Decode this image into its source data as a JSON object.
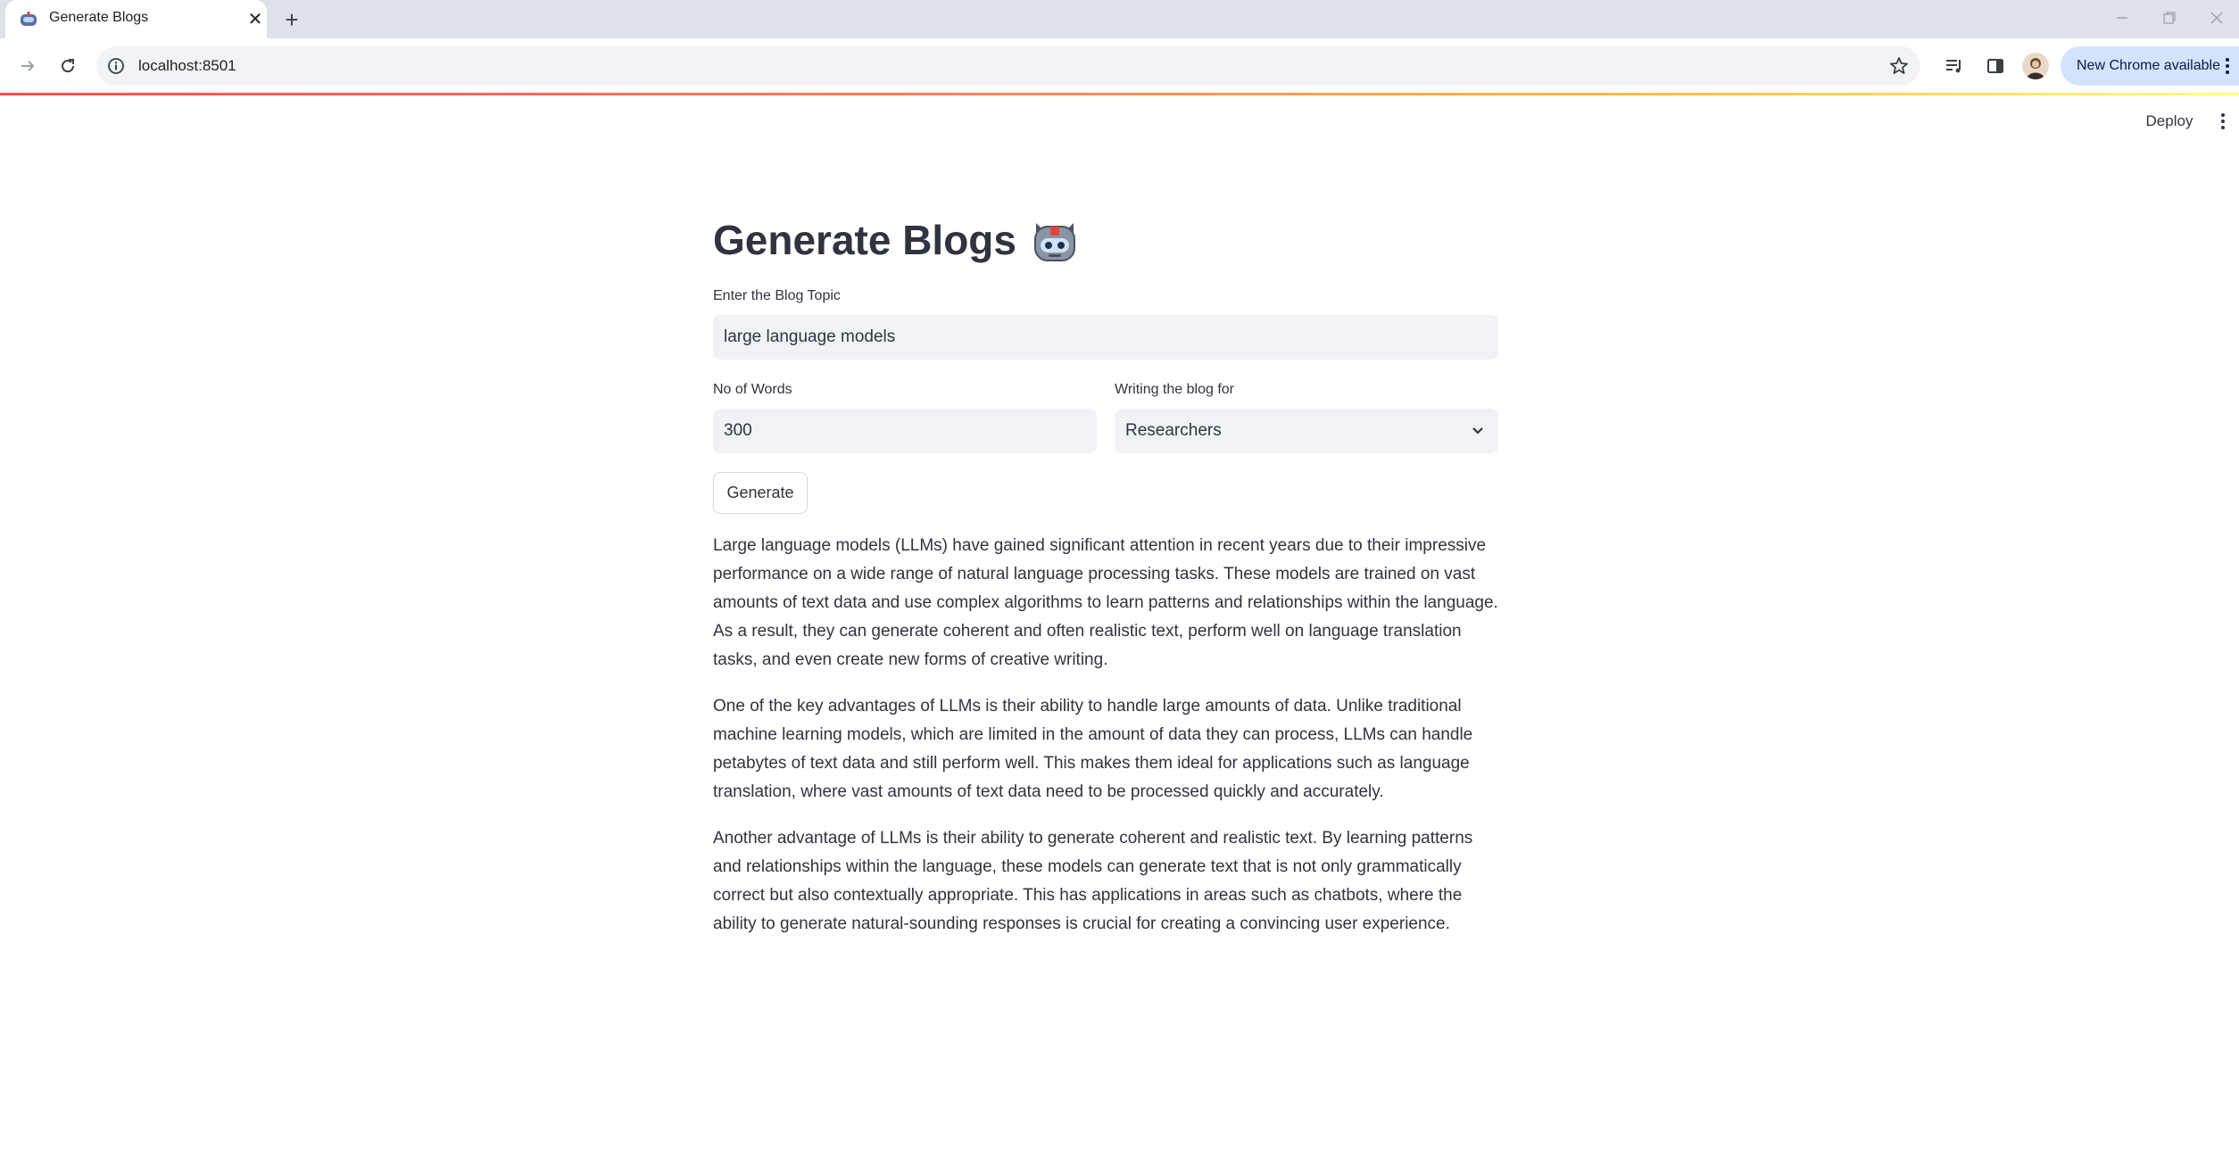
{
  "browser": {
    "tab_title": "Generate Blogs",
    "url": "localhost:8501",
    "update_button": "New Chrome available"
  },
  "app": {
    "deploy_label": "Deploy",
    "title": "Generate Blogs",
    "title_emoji": "robot-face",
    "topic": {
      "label": "Enter the Blog Topic",
      "value": "large language models"
    },
    "words": {
      "label": "No of Words",
      "value": "300"
    },
    "audience": {
      "label": "Writing the blog for",
      "selected": "Researchers"
    },
    "generate_label": "Generate",
    "output_paragraphs": [
      "Large language models (LLMs) have gained significant attention in recent years due to their impressive performance on a wide range of natural language processing tasks. These models are trained on vast amounts of text data and use complex algorithms to learn patterns and relationships within the language. As a result, they can generate coherent and often realistic text, perform well on language translation tasks, and even create new forms of creative writing.",
      "One of the key advantages of LLMs is their ability to handle large amounts of data. Unlike traditional machine learning models, which are limited in the amount of data they can process, LLMs can handle petabytes of text data and still perform well. This makes them ideal for applications such as language translation, where vast amounts of text data need to be processed quickly and accurately.",
      "Another advantage of LLMs is their ability to generate coherent and realistic text. By learning patterns and relationships within the language, these models can generate text that is not only grammatically correct but also contextually appropriate. This has applications in areas such as chatbots, where the ability to generate natural-sounding responses is crucial for creating a convincing user experience."
    ]
  },
  "colors": {
    "accent": "#ff4b4b",
    "input_bg": "#f0f2f6",
    "text": "#31333f",
    "tabstrip": "#dee3eb"
  }
}
